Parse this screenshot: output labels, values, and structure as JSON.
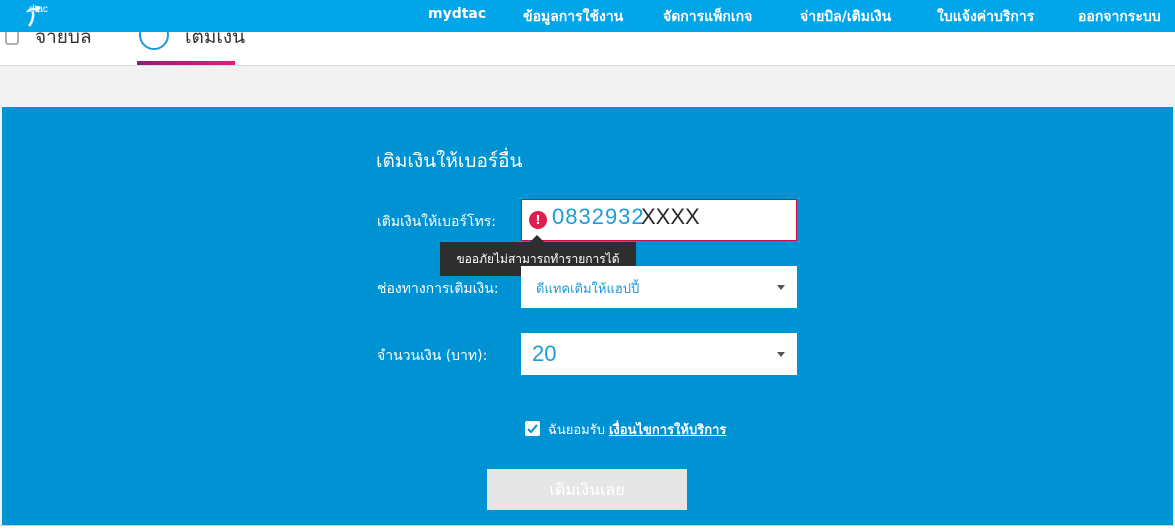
{
  "brand": {
    "logo_text": "dtac"
  },
  "nav": {
    "items": [
      {
        "label": "mydtac"
      },
      {
        "label": "ข้อมูลการใช้งาน"
      },
      {
        "label": "จัดการแพ็กเกจ"
      },
      {
        "label": "จ่ายบิล/เติมเงิน"
      },
      {
        "label": "ใบแจ้งค่าบริการ"
      },
      {
        "label": "ออกจากระบบ"
      }
    ],
    "active": "จ่ายบิล/เติมเงิน"
  },
  "subtabs": [
    {
      "label": "จ่ายบิล"
    },
    {
      "label": "เติมเงิน"
    }
  ],
  "form": {
    "title": "เติมเงินให้เบอร์อื่น",
    "phone_label": "เติมเงินให้เบอร์โทร:",
    "phone_value": "0832932",
    "phone_mask": "XXXX",
    "error_tooltip": "ขออภัยไม่สามารถทำรายการได้",
    "channel_label": "ช่องทางการเติมเงิน:",
    "channel_value": "ดีแทคเติมให้แฮปปี้",
    "amount_label": "จำนวนเงิน (บาท):",
    "amount_value": "20",
    "agree_text": "ฉันยอมรับ",
    "agree_link": "เงื่อนไขการให้บริการ",
    "agree_checked": true,
    "submit_label": "เติมเงินเลย"
  },
  "colors": {
    "topbar": "#00a6e8",
    "panel": "#0093d4",
    "accent": "#ee2a7b",
    "error": "#e01d4f"
  }
}
